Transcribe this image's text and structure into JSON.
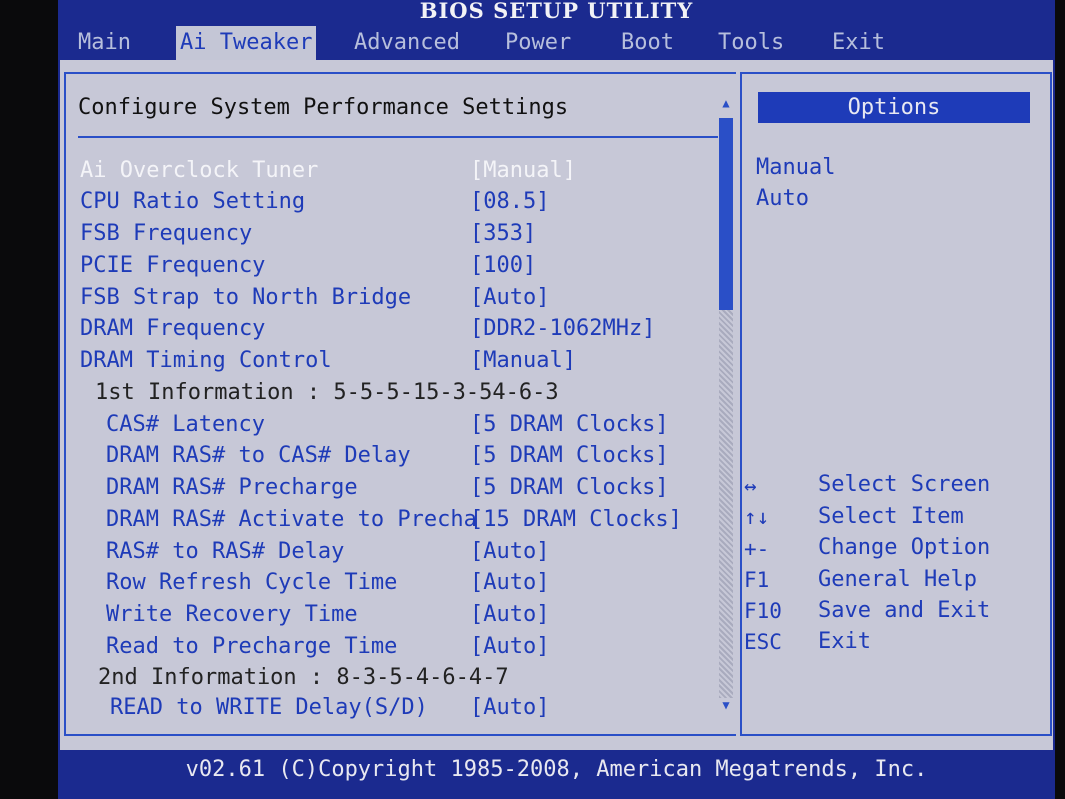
{
  "title": "BIOS SETUP UTILITY",
  "menu": [
    "Main",
    "Ai Tweaker",
    "Advanced",
    "Power",
    "Boot",
    "Tools",
    "Exit"
  ],
  "active_menu_index": 1,
  "section_title": "Configure System Performance Settings",
  "settings": [
    {
      "label": "Ai Overclock Tuner",
      "value": "[Manual]"
    },
    {
      "label": "CPU Ratio Setting",
      "value": "[08.5]"
    },
    {
      "label": "FSB Frequency",
      "value": "[353]"
    },
    {
      "label": "PCIE Frequency",
      "value": "[100]"
    },
    {
      "label": "FSB Strap to North Bridge",
      "value": "[Auto]"
    },
    {
      "label": "DRAM Frequency",
      "value": "[DDR2-1062MHz]"
    },
    {
      "label": "DRAM Timing Control",
      "value": "[Manual]"
    },
    {
      "label": "1st Information : 5-5-5-15-3-54-6-3",
      "value": ""
    },
    {
      "label": "CAS# Latency",
      "value": "[5 DRAM Clocks]"
    },
    {
      "label": "DRAM RAS# to CAS# Delay",
      "value": "[5 DRAM Clocks]"
    },
    {
      "label": "DRAM RAS# Precharge",
      "value": "[5 DRAM Clocks]"
    },
    {
      "label": "DRAM RAS# Activate to Precha",
      "value": "[15 DRAM Clocks]"
    },
    {
      "label": "RAS# to RAS# Delay",
      "value": "[Auto]"
    },
    {
      "label": "Row Refresh Cycle Time",
      "value": "[Auto]"
    },
    {
      "label": "Write Recovery Time",
      "value": "[Auto]"
    },
    {
      "label": "Read to Precharge Time",
      "value": "[Auto]"
    },
    {
      "label": "2nd Information : 8-3-5-4-6-4-7",
      "value": ""
    },
    {
      "label": "READ to WRITE Delay(S/D)",
      "value": "[Auto]"
    }
  ],
  "options_header": "Options",
  "options": [
    "Manual",
    "Auto"
  ],
  "help_keys": [
    {
      "key": "↔",
      "desc": "Select Screen"
    },
    {
      "key": "↑↓",
      "desc": "Select Item"
    },
    {
      "key": "+-",
      "desc": "Change Option"
    },
    {
      "key": "F1",
      "desc": "General Help"
    },
    {
      "key": "F10",
      "desc": "Save and Exit"
    },
    {
      "key": "ESC",
      "desc": "Exit"
    }
  ],
  "footer": "v02.61 (C)Copyright 1985-2008, American Megatrends, Inc.",
  "colors": {
    "screen": "#1b2a8f",
    "panel": "#c7c8d7",
    "accent": "#1e3bb8",
    "selected": "#f4f4f8"
  }
}
